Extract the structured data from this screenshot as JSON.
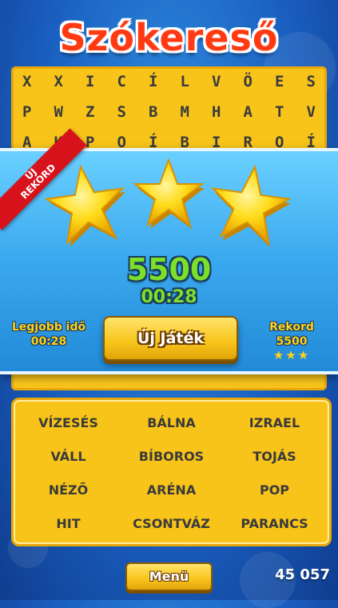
{
  "title": "Szókereső",
  "grid": {
    "rows": [
      [
        "X",
        "X",
        "I",
        "C",
        "Í",
        "L",
        "V",
        "Ö",
        "E",
        "S"
      ],
      [
        "P",
        "W",
        "Z",
        "S",
        "B",
        "M",
        "H",
        "A",
        "T",
        "V"
      ],
      [
        "A",
        "K",
        "P",
        "O",
        "Í",
        "B",
        "I",
        "R",
        "O",
        "Í"
      ]
    ]
  },
  "result": {
    "ribbon_line1": "ÚJ",
    "ribbon_line2": "REKORD",
    "stars_earned": 3,
    "stars_total": 3,
    "score": "5500",
    "time": "00:28",
    "best_time_label": "Legjobb idő",
    "best_time_value": "00:28",
    "new_game_label": "Új Játék",
    "record_label": "Rekord",
    "record_value": "5500",
    "record_stars": "★★★"
  },
  "words": [
    "VÍZESÉS",
    "BÁLNA",
    "IZRAEL",
    "VÁLL",
    "BÍBOROS",
    "TOJÁS",
    "NÉZŐ",
    "ARÉNA",
    "POP",
    "HIT",
    "CSONTVÁZ",
    "PARANCS"
  ],
  "bottom": {
    "menu_label": "Menü",
    "coins": "45 057"
  },
  "colors": {
    "background": "#1a5fc0",
    "panel_yellow": "#f8c41a",
    "title_red": "#ff3a12",
    "score_green": "#7be02a",
    "ribbon_red": "#d8121b"
  }
}
